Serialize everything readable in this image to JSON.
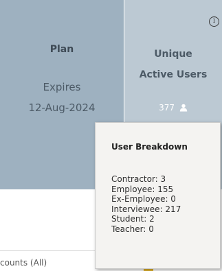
{
  "plan_card": {
    "title": "Plan",
    "expires_label": "Expires",
    "expiry_date": "12-Aug-2024"
  },
  "users_card": {
    "title_line1": "Unique",
    "title_line2": "Active Users",
    "count": "377",
    "info_icon": "i"
  },
  "accounts_label": "counts (All)",
  "breakdown_tooltip": {
    "title": "User Breakdown",
    "items": [
      "Contractor: 3",
      "Employee: 155",
      "Ex-Employee: 0",
      "Interviewee: 217",
      "Student: 2",
      "Teacher: 0"
    ]
  },
  "colors": {
    "plan_card_bg": "#9eb1c0",
    "users_card_bg": "#bcc9d3",
    "tooltip_bg": "#f4f3f1",
    "accent_yellow": "#e5b52c"
  },
  "icons": {
    "info": "info-icon",
    "user": "person-icon"
  }
}
